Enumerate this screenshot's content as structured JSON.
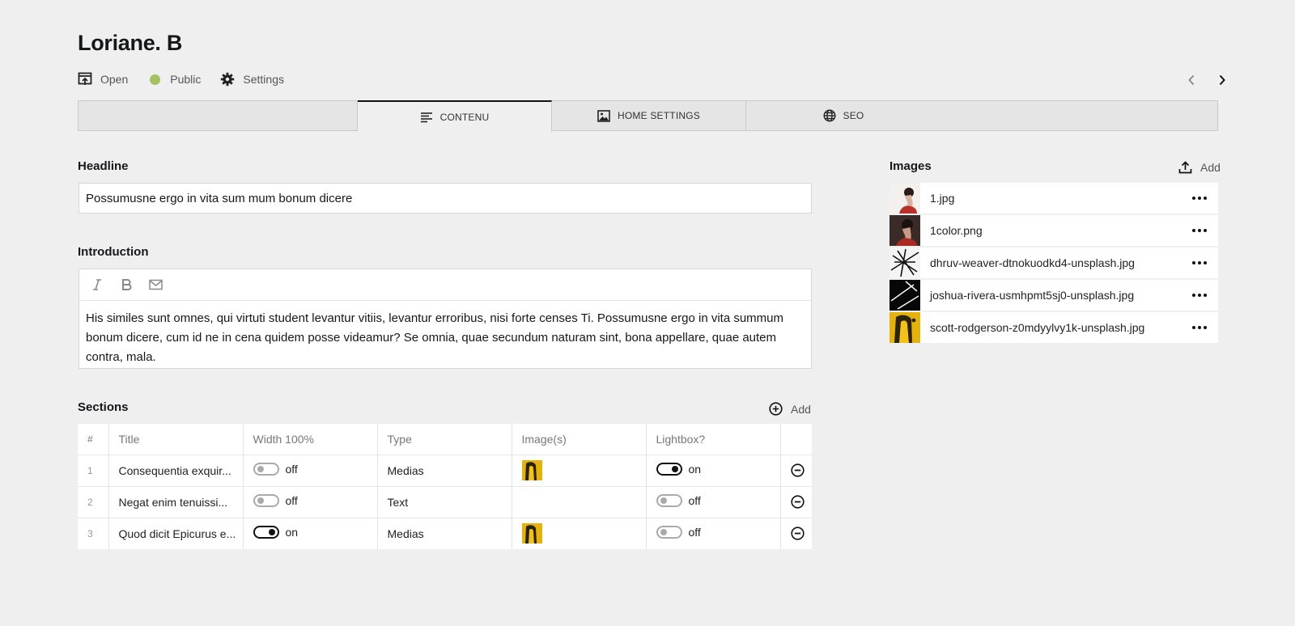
{
  "title": "Loriane. B",
  "meta": {
    "open_label": "Open",
    "public_label": "Public",
    "settings_label": "Settings",
    "status_color": "#a7c062"
  },
  "tabs": [
    {
      "label": "CONTENU",
      "icon": "text-align-icon",
      "active": true
    },
    {
      "label": "HOME SETTINGS",
      "icon": "image-icon",
      "active": false
    },
    {
      "label": "SEO",
      "icon": "globe-icon",
      "active": false
    }
  ],
  "headline": {
    "label": "Headline",
    "value": "Possumusne ergo in vita sum mum bonum dicere"
  },
  "introduction": {
    "label": "Introduction",
    "toolbar": [
      "italic-icon",
      "bold-icon",
      "email-icon"
    ],
    "value": "His similes sunt omnes, qui virtuti student levantur vitiis, levantur erroribus, nisi forte censes Ti. Possumusne ergo in vita summum bonum dicere, cum id ne in cena quidem posse videamur? Se omnia, quae secundum naturam sint, bona appellare, quae autem contra, mala."
  },
  "sections": {
    "label": "Sections",
    "add_label": "Add",
    "columns": [
      "#",
      "Title",
      "Width 100%",
      "Type",
      "Image(s)",
      "Lightbox?"
    ],
    "rows": [
      {
        "num": "1",
        "title": "Consequentia exquir...",
        "width": "off",
        "type": "Medias",
        "has_image": true,
        "lightbox": "on"
      },
      {
        "num": "2",
        "title": "Negat enim tenuissi...",
        "width": "off",
        "type": "Text",
        "has_image": false,
        "lightbox": "off"
      },
      {
        "num": "3",
        "title": "Quod dicit Epicurus e...",
        "width": "on",
        "type": "Medias",
        "has_image": true,
        "lightbox": "off"
      }
    ]
  },
  "images": {
    "label": "Images",
    "add_label": "Add",
    "files": [
      {
        "name": "1.jpg"
      },
      {
        "name": "1color.png"
      },
      {
        "name": "dhruv-weaver-dtnokuodkd4-unsplash.jpg"
      },
      {
        "name": "joshua-rivera-usmhpmt5sj0-unsplash.jpg"
      },
      {
        "name": "scott-rodgerson-z0mdyylvy1k-unsplash.jpg"
      }
    ]
  }
}
